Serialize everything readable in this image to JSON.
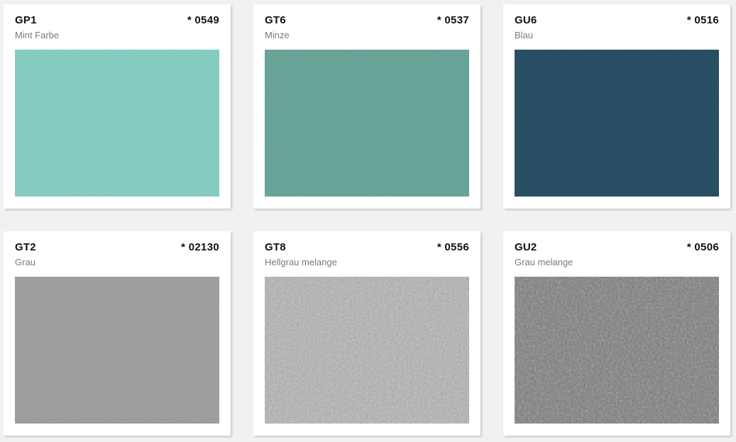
{
  "swatches": [
    {
      "code": "GP1",
      "number": "* 0549",
      "name": "Mint Farbe",
      "color": "#7fcdc1"
    },
    {
      "code": "GT6",
      "number": "* 0537",
      "name": "Minze",
      "color": "#5fa193"
    },
    {
      "code": "GU6",
      "number": "* 0516",
      "name": "Blau",
      "color": "#164159"
    },
    {
      "code": "GT2",
      "number": "* 02130",
      "name": "Grau",
      "color": "#9a9a9a"
    },
    {
      "code": "GT8",
      "number": "* 0556",
      "name": "Hellgrau melange",
      "color": "#b3b3b3"
    },
    {
      "code": "GU2",
      "number": "* 0506",
      "name": "Grau melange",
      "color": "#7a7a7a"
    }
  ]
}
